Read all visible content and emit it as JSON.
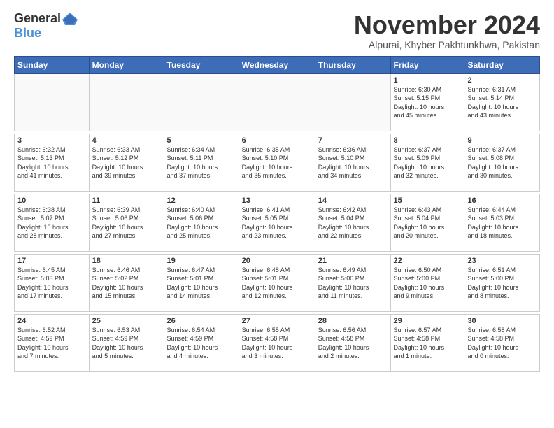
{
  "logo": {
    "general": "General",
    "blue": "Blue"
  },
  "title": "November 2024",
  "location": "Alpurai, Khyber Pakhtunkhwa, Pakistan",
  "headers": [
    "Sunday",
    "Monday",
    "Tuesday",
    "Wednesday",
    "Thursday",
    "Friday",
    "Saturday"
  ],
  "weeks": [
    [
      {
        "day": "",
        "info": ""
      },
      {
        "day": "",
        "info": ""
      },
      {
        "day": "",
        "info": ""
      },
      {
        "day": "",
        "info": ""
      },
      {
        "day": "",
        "info": ""
      },
      {
        "day": "1",
        "info": "Sunrise: 6:30 AM\nSunset: 5:15 PM\nDaylight: 10 hours\nand 45 minutes."
      },
      {
        "day": "2",
        "info": "Sunrise: 6:31 AM\nSunset: 5:14 PM\nDaylight: 10 hours\nand 43 minutes."
      }
    ],
    [
      {
        "day": "3",
        "info": "Sunrise: 6:32 AM\nSunset: 5:13 PM\nDaylight: 10 hours\nand 41 minutes."
      },
      {
        "day": "4",
        "info": "Sunrise: 6:33 AM\nSunset: 5:12 PM\nDaylight: 10 hours\nand 39 minutes."
      },
      {
        "day": "5",
        "info": "Sunrise: 6:34 AM\nSunset: 5:11 PM\nDaylight: 10 hours\nand 37 minutes."
      },
      {
        "day": "6",
        "info": "Sunrise: 6:35 AM\nSunset: 5:10 PM\nDaylight: 10 hours\nand 35 minutes."
      },
      {
        "day": "7",
        "info": "Sunrise: 6:36 AM\nSunset: 5:10 PM\nDaylight: 10 hours\nand 34 minutes."
      },
      {
        "day": "8",
        "info": "Sunrise: 6:37 AM\nSunset: 5:09 PM\nDaylight: 10 hours\nand 32 minutes."
      },
      {
        "day": "9",
        "info": "Sunrise: 6:37 AM\nSunset: 5:08 PM\nDaylight: 10 hours\nand 30 minutes."
      }
    ],
    [
      {
        "day": "10",
        "info": "Sunrise: 6:38 AM\nSunset: 5:07 PM\nDaylight: 10 hours\nand 28 minutes."
      },
      {
        "day": "11",
        "info": "Sunrise: 6:39 AM\nSunset: 5:06 PM\nDaylight: 10 hours\nand 27 minutes."
      },
      {
        "day": "12",
        "info": "Sunrise: 6:40 AM\nSunset: 5:06 PM\nDaylight: 10 hours\nand 25 minutes."
      },
      {
        "day": "13",
        "info": "Sunrise: 6:41 AM\nSunset: 5:05 PM\nDaylight: 10 hours\nand 23 minutes."
      },
      {
        "day": "14",
        "info": "Sunrise: 6:42 AM\nSunset: 5:04 PM\nDaylight: 10 hours\nand 22 minutes."
      },
      {
        "day": "15",
        "info": "Sunrise: 6:43 AM\nSunset: 5:04 PM\nDaylight: 10 hours\nand 20 minutes."
      },
      {
        "day": "16",
        "info": "Sunrise: 6:44 AM\nSunset: 5:03 PM\nDaylight: 10 hours\nand 18 minutes."
      }
    ],
    [
      {
        "day": "17",
        "info": "Sunrise: 6:45 AM\nSunset: 5:03 PM\nDaylight: 10 hours\nand 17 minutes."
      },
      {
        "day": "18",
        "info": "Sunrise: 6:46 AM\nSunset: 5:02 PM\nDaylight: 10 hours\nand 15 minutes."
      },
      {
        "day": "19",
        "info": "Sunrise: 6:47 AM\nSunset: 5:01 PM\nDaylight: 10 hours\nand 14 minutes."
      },
      {
        "day": "20",
        "info": "Sunrise: 6:48 AM\nSunset: 5:01 PM\nDaylight: 10 hours\nand 12 minutes."
      },
      {
        "day": "21",
        "info": "Sunrise: 6:49 AM\nSunset: 5:00 PM\nDaylight: 10 hours\nand 11 minutes."
      },
      {
        "day": "22",
        "info": "Sunrise: 6:50 AM\nSunset: 5:00 PM\nDaylight: 10 hours\nand 9 minutes."
      },
      {
        "day": "23",
        "info": "Sunrise: 6:51 AM\nSunset: 5:00 PM\nDaylight: 10 hours\nand 8 minutes."
      }
    ],
    [
      {
        "day": "24",
        "info": "Sunrise: 6:52 AM\nSunset: 4:59 PM\nDaylight: 10 hours\nand 7 minutes."
      },
      {
        "day": "25",
        "info": "Sunrise: 6:53 AM\nSunset: 4:59 PM\nDaylight: 10 hours\nand 5 minutes."
      },
      {
        "day": "26",
        "info": "Sunrise: 6:54 AM\nSunset: 4:59 PM\nDaylight: 10 hours\nand 4 minutes."
      },
      {
        "day": "27",
        "info": "Sunrise: 6:55 AM\nSunset: 4:58 PM\nDaylight: 10 hours\nand 3 minutes."
      },
      {
        "day": "28",
        "info": "Sunrise: 6:56 AM\nSunset: 4:58 PM\nDaylight: 10 hours\nand 2 minutes."
      },
      {
        "day": "29",
        "info": "Sunrise: 6:57 AM\nSunset: 4:58 PM\nDaylight: 10 hours\nand 1 minute."
      },
      {
        "day": "30",
        "info": "Sunrise: 6:58 AM\nSunset: 4:58 PM\nDaylight: 10 hours\nand 0 minutes."
      }
    ]
  ]
}
